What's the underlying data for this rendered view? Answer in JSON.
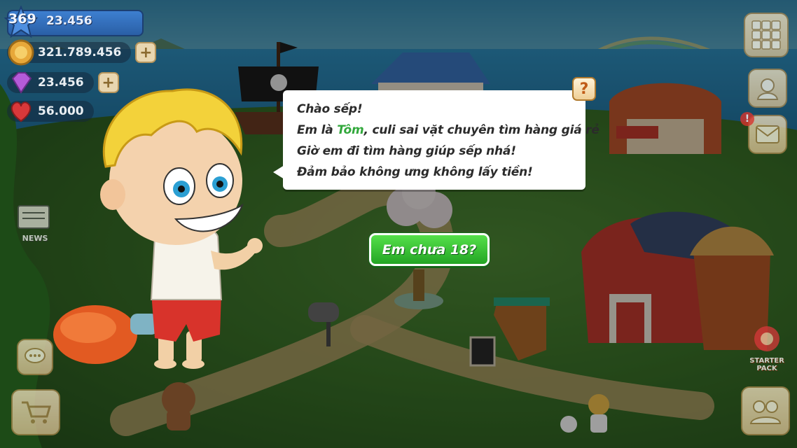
{
  "hud": {
    "level": "369",
    "xp": "23.456",
    "gold": "321.789.456",
    "gems": "23.456",
    "hearts": "56.000"
  },
  "dialog": {
    "line1": "Chào sếp!",
    "line2_prefix": "Em là ",
    "line2_name": "Tôm",
    "line2_suffix": ", culi sai vặt chuyên tìm hàng giá rẻ",
    "line3": "Giờ em đi tìm hàng giúp sếp nhá!",
    "line4": "Đảm bảo không ưng không lấy tiền!",
    "help_label": "?"
  },
  "cta": {
    "label": "Em chưa 18?"
  },
  "side": {
    "news_label": "NEWS",
    "starter_label_1": "STARTER",
    "starter_label_2": "PACK",
    "mail_alert": "!"
  },
  "colors": {
    "accent_green": "#32a83c",
    "button_green": "#2fbb2c",
    "panel_beige": "#e8d6b0"
  },
  "icons": [
    "level-star-icon",
    "gold-coin-icon",
    "gem-icon",
    "heart-icon",
    "plus-icon",
    "grid-icon",
    "avatar-icon",
    "mail-icon",
    "news-icon",
    "chat-icon",
    "cart-icon",
    "starter-pack-icon",
    "friends-icon",
    "help-icon"
  ]
}
